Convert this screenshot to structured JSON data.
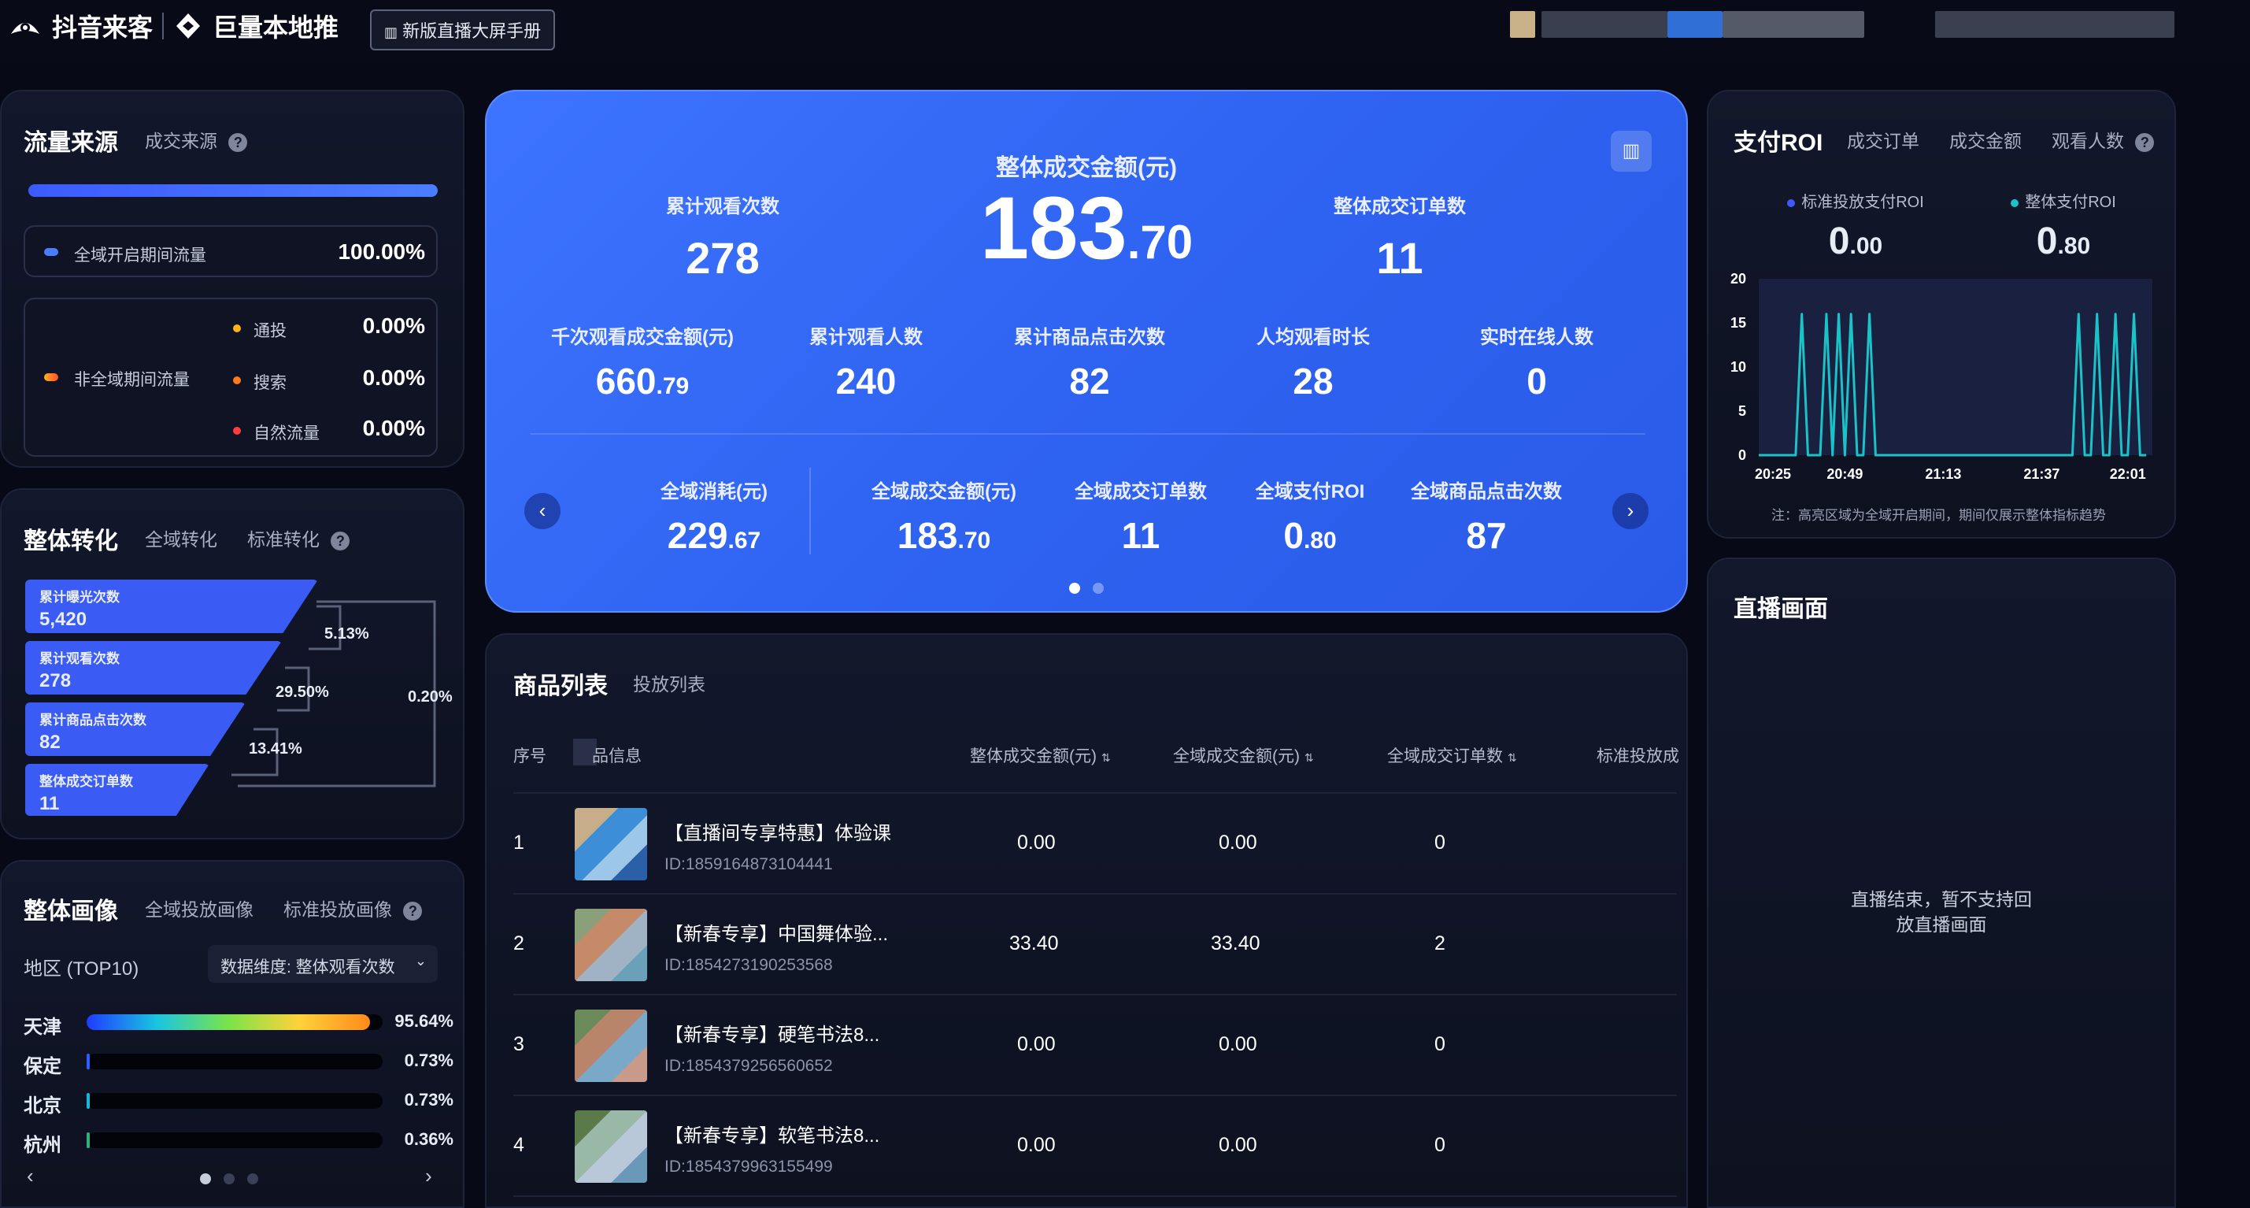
{
  "topbar": {
    "brand1": "抖音来客",
    "brand2": "巨量本地推",
    "manual_btn": "新版直播大屏手册"
  },
  "traffic": {
    "title": "流量来源",
    "tab": "成交来源",
    "all_label": "全域开启期间流量",
    "all_value": "100.00%",
    "non_all_label": "非全域期间流量",
    "items": [
      {
        "label": "通投",
        "value": "0.00%"
      },
      {
        "label": "搜索",
        "value": "0.00%"
      },
      {
        "label": "自然流量",
        "value": "0.00%"
      }
    ]
  },
  "conversion": {
    "title": "整体转化",
    "tab1": "全域转化",
    "tab2": "标准转化",
    "funnel": [
      {
        "label": "累计曝光次数",
        "value": "5,420"
      },
      {
        "label": "累计观看次数",
        "value": "278"
      },
      {
        "label": "累计商品点击次数",
        "value": "82"
      },
      {
        "label": "整体成交订单数",
        "value": "11"
      }
    ],
    "rates": {
      "r1": "5.13%",
      "r2": "29.50%",
      "r3": "13.41%",
      "overall": "0.20%"
    }
  },
  "portrait": {
    "title": "整体画像",
    "tab1": "全域投放画像",
    "tab2": "标准投放画像",
    "region_label": "地区 (TOP10)",
    "dimension": "数据维度: 整体观看次数",
    "regions": [
      {
        "name": "天津",
        "value": "95.64%",
        "fraction": 0.9564
      },
      {
        "name": "保定",
        "value": "0.73%",
        "fraction": 0.0073
      },
      {
        "name": "北京",
        "value": "0.73%",
        "fraction": 0.0073
      },
      {
        "name": "杭州",
        "value": "0.36%",
        "fraction": 0.0036
      }
    ]
  },
  "hero": {
    "main_label": "整体成交金额(元)",
    "main_int": "183",
    "main_dec": ".70",
    "left_label": "累计观看次数",
    "left_value": "278",
    "right_label": "整体成交订单数",
    "right_value": "11",
    "row2": [
      {
        "label": "千次观看成交金额(元)",
        "int": "660",
        "dec": ".79"
      },
      {
        "label": "累计观看人数",
        "int": "240",
        "dec": ""
      },
      {
        "label": "累计商品点击次数",
        "int": "82",
        "dec": ""
      },
      {
        "label": "人均观看时长",
        "int": "28",
        "dec": ""
      },
      {
        "label": "实时在线人数",
        "int": "0",
        "dec": ""
      }
    ],
    "row3": [
      {
        "label": "全域消耗(元)",
        "int": "229",
        "dec": ".67"
      },
      {
        "label": "全域成交金额(元)",
        "int": "183",
        "dec": ".70"
      },
      {
        "label": "全域成交订单数",
        "int": "11",
        "dec": ""
      },
      {
        "label": "全域支付ROI",
        "int": "0",
        "dec": ".80"
      },
      {
        "label": "全域商品点击次数",
        "int": "87",
        "dec": ""
      }
    ]
  },
  "products": {
    "title": "商品列表",
    "tab": "投放列表",
    "headers": [
      "序号",
      "品信息",
      "整体成交金额(元)",
      "全域成交金额(元)",
      "全域成交订单数",
      "标准投放成交"
    ],
    "rows": [
      {
        "idx": "1",
        "name": "【直播间专享特惠】体验课",
        "id": "ID:1859164873104441",
        "total": "0.00",
        "all": "0.00",
        "orders": "0"
      },
      {
        "idx": "2",
        "name": "【新春专享】中国舞体验...",
        "id": "ID:1854273190253568",
        "total": "33.40",
        "all": "33.40",
        "orders": "2"
      },
      {
        "idx": "3",
        "name": "【新春专享】硬笔书法8...",
        "id": "ID:1854379256560652",
        "total": "0.00",
        "all": "0.00",
        "orders": "0"
      },
      {
        "idx": "4",
        "name": "【新春专享】软笔书法8...",
        "id": "ID:1854379963155499",
        "total": "0.00",
        "all": "0.00",
        "orders": "0"
      }
    ]
  },
  "roi": {
    "title": "支付ROI",
    "tab1": "成交订单",
    "tab2": "成交金额",
    "tab3": "观看人数",
    "legend1": "标准投放支付ROI",
    "legend2": "整体支付ROI",
    "value1_int": "0",
    "value1_dec": ".00",
    "value2_int": "0",
    "value2_dec": ".80",
    "note": "注：高亮区域为全域开启期间，期间仅展示整体指标趋势"
  },
  "chart_data": {
    "type": "line",
    "title": "",
    "xlabel": "",
    "ylabel": "",
    "ylim": [
      0,
      20
    ],
    "yticks": [
      0,
      5,
      10,
      15,
      20
    ],
    "xticks": [
      "20:25",
      "20:49",
      "21:13",
      "21:37",
      "22:01"
    ],
    "series": [
      {
        "color": "#19c3c8",
        "x": [
          0,
          6,
          7,
          8,
          9,
          10,
          11,
          12,
          13,
          14,
          15,
          16,
          17,
          18,
          19,
          20,
          21,
          50,
          51,
          52,
          53,
          54,
          55,
          56,
          57,
          58,
          59,
          60,
          61,
          62,
          63
        ],
        "y": [
          0,
          0,
          16,
          0,
          0,
          0,
          16,
          0,
          16,
          0,
          16,
          0,
          0,
          16,
          0,
          0,
          0,
          0,
          0,
          16,
          0,
          0,
          16,
          0,
          0,
          16,
          0,
          0,
          16,
          0,
          0
        ]
      }
    ],
    "grid": false,
    "legend": "top"
  },
  "live": {
    "title": "直播画面",
    "message1": "直播结束，暂不支持回",
    "message2": "放直播画面"
  }
}
